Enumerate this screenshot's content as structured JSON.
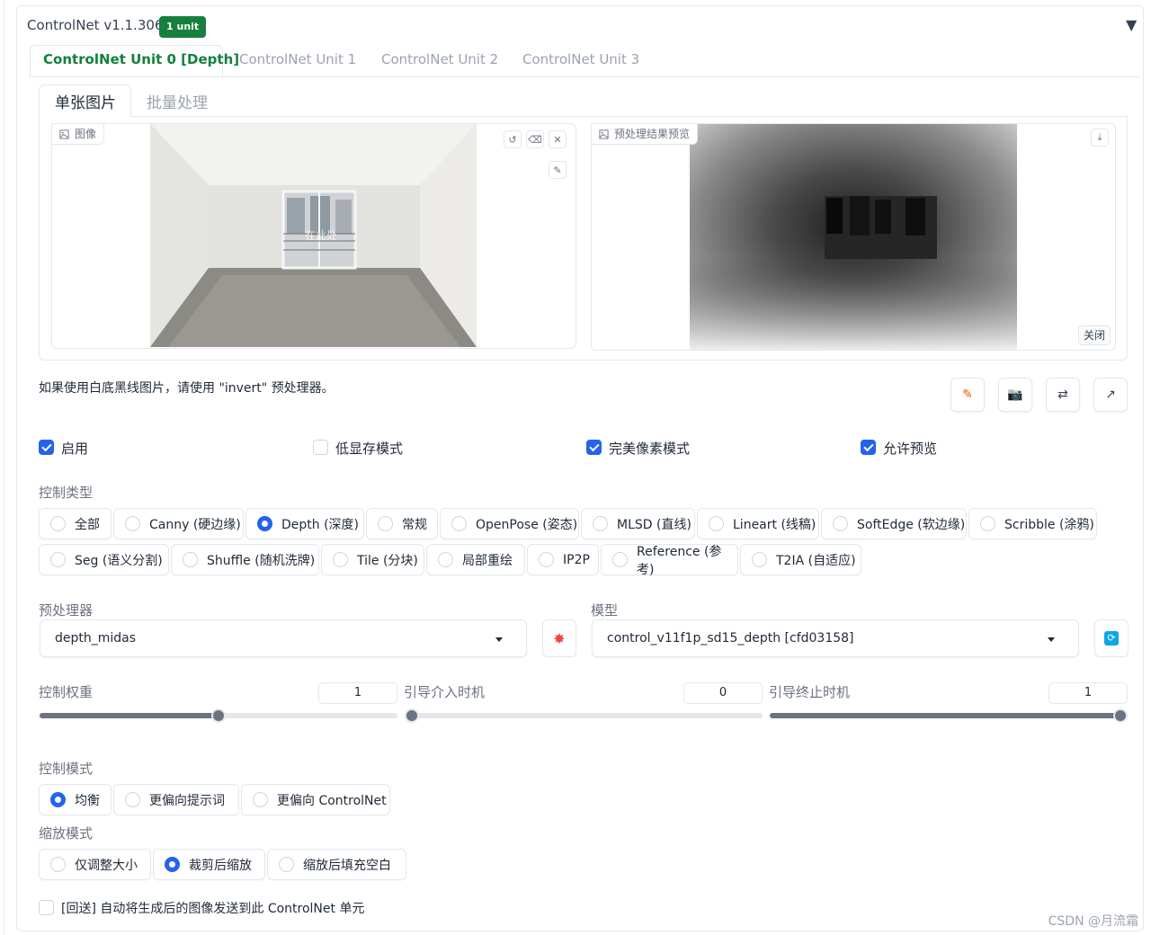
{
  "accordion": {
    "title": "ControlNet v1.1.306",
    "badge": "1 unit",
    "collapse_icon": "triangle-down-icon"
  },
  "unit_tabs": [
    "ControlNet Unit 0 [Depth]",
    "ControlNet Unit 1",
    "ControlNet Unit 2",
    "ControlNet Unit 3"
  ],
  "sub_tabs": [
    "单张图片",
    "批量处理"
  ],
  "input_image": {
    "label": "图像",
    "label_icon": "image-icon",
    "overlay_text": "在此处"
  },
  "preview_image": {
    "label": "预处理结果预览",
    "label_icon": "image-icon",
    "close_label": "关闭"
  },
  "hint": "如果使用白底黑线图片，请使用 \"invert\" 预处理器。",
  "checkboxes": [
    {
      "label": "启用",
      "checked": true
    },
    {
      "label": "低显存模式",
      "checked": false
    },
    {
      "label": "完美像素模式",
      "checked": true
    },
    {
      "label": "允许预览",
      "checked": true
    }
  ],
  "control_type": {
    "label": "控制类型",
    "row1": [
      "全部",
      "Canny (硬边缘)",
      "Depth (深度)",
      "常规",
      "OpenPose (姿态)",
      "MLSD (直线)",
      "Lineart (线稿)",
      "SoftEdge (软边缘)",
      "Scribble (涂鸦)"
    ],
    "row2": [
      "Seg (语义分割)",
      "Shuffle (随机洗牌)",
      "Tile (分块)",
      "局部重绘",
      "IP2P",
      "Reference (参考)",
      "T2IA (自适应)"
    ],
    "selected": "Depth (深度)"
  },
  "preprocessor": {
    "label": "预处理器",
    "value": "depth_midas",
    "run_icon": "explosion-icon"
  },
  "model": {
    "label": "模型",
    "value": "control_v11f1p_sd15_depth [cfd03158]",
    "refresh_icon": "refresh-icon"
  },
  "sliders": [
    {
      "label": "控制权重",
      "value": "1",
      "min": 0,
      "max": 2,
      "fraction": 0.5
    },
    {
      "label": "引导介入时机",
      "value": "0",
      "min": 0,
      "max": 1,
      "fraction": 0
    },
    {
      "label": "引导终止时机",
      "value": "1",
      "min": 0,
      "max": 1,
      "fraction": 1
    }
  ],
  "control_mode": {
    "label": "控制模式",
    "options": [
      "均衡",
      "更偏向提示词",
      "更偏向 ControlNet"
    ],
    "selected": "均衡"
  },
  "resize_mode": {
    "label": "缩放模式",
    "options": [
      "仅调整大小",
      "裁剪后缩放",
      "缩放后填充空白"
    ],
    "selected": "裁剪后缩放"
  },
  "loopback": {
    "label": "[回送] 自动将生成后的图像发送到此 ControlNet 单元",
    "checked": false
  },
  "watermark": "CSDN @月流霜",
  "colors": {
    "accent_green": "#15803d",
    "accent_blue": "#2563eb"
  }
}
